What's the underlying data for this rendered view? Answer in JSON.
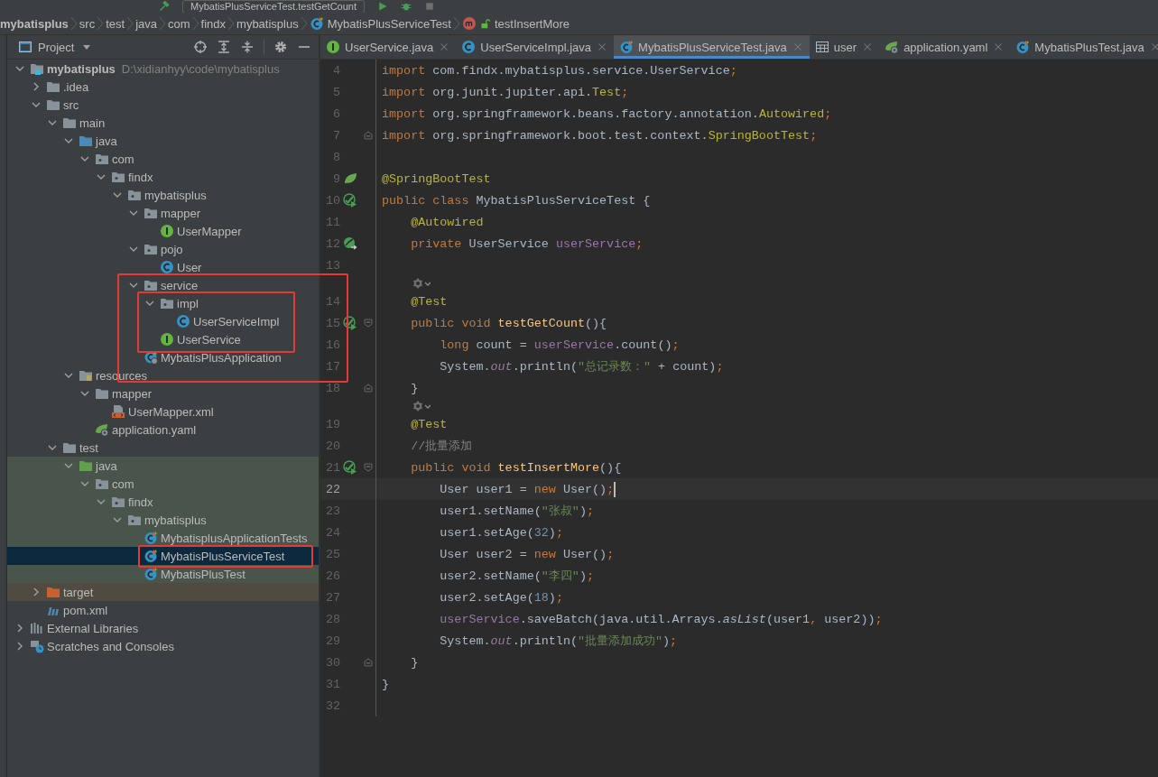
{
  "toolbar": {
    "run_configuration": "MybatisPlusServiceTest.testGetCount"
  },
  "breadcrumbs": [
    {
      "label": "mybatisplus",
      "kind": "module"
    },
    {
      "label": "src",
      "kind": "folder"
    },
    {
      "label": "test",
      "kind": "folder"
    },
    {
      "label": "java",
      "kind": "folder"
    },
    {
      "label": "com",
      "kind": "folder"
    },
    {
      "label": "findx",
      "kind": "folder"
    },
    {
      "label": "mybatisplus",
      "kind": "folder"
    },
    {
      "label": "MybatisPlusServiceTest",
      "kind": "test-class"
    },
    {
      "label": "testInsertMore",
      "kind": "method"
    }
  ],
  "project_panel": {
    "title": "Project",
    "tree": [
      {
        "label": "mybatisplus",
        "path": "D:\\xidianhyy\\code\\mybatisplus",
        "kind": "module",
        "expanded": true,
        "selected": false,
        "children": [
          {
            "label": ".idea",
            "kind": "folder",
            "expanded": false,
            "selected": false
          },
          {
            "label": "src",
            "kind": "folder",
            "expanded": true,
            "selected": false,
            "children": [
              {
                "label": "main",
                "kind": "folder",
                "expanded": true,
                "selected": false,
                "children": [
                  {
                    "label": "java",
                    "kind": "source",
                    "expanded": true,
                    "selected": false,
                    "children": [
                      {
                        "label": "com",
                        "kind": "package",
                        "expanded": true,
                        "selected": false,
                        "children": [
                          {
                            "label": "findx",
                            "kind": "package",
                            "expanded": true,
                            "selected": false,
                            "children": [
                              {
                                "label": "mybatisplus",
                                "kind": "package",
                                "expanded": true,
                                "selected": false,
                                "children": [
                                  {
                                    "label": "mapper",
                                    "kind": "package",
                                    "expanded": true,
                                    "selected": false,
                                    "children": [
                                      {
                                        "label": "UserMapper",
                                        "kind": "interface",
                                        "selected": false
                                      }
                                    ]
                                  },
                                  {
                                    "label": "pojo",
                                    "kind": "package",
                                    "expanded": true,
                                    "selected": false,
                                    "children": [
                                      {
                                        "label": "User",
                                        "kind": "class",
                                        "selected": false
                                      }
                                    ]
                                  },
                                  {
                                    "label": "service",
                                    "kind": "package",
                                    "expanded": true,
                                    "selected": false,
                                    "children": [
                                      {
                                        "label": "impl",
                                        "kind": "package",
                                        "expanded": true,
                                        "selected": false,
                                        "children": [
                                          {
                                            "label": "UserServiceImpl",
                                            "kind": "class",
                                            "selected": false
                                          }
                                        ]
                                      },
                                      {
                                        "label": "UserService",
                                        "kind": "interface",
                                        "selected": false
                                      }
                                    ]
                                  },
                                  {
                                    "label": "MybatisPlusApplication",
                                    "kind": "app-class",
                                    "selected": false
                                  }
                                ]
                              }
                            ]
                          }
                        ]
                      }
                    ]
                  },
                  {
                    "label": "resources",
                    "kind": "resources",
                    "expanded": true,
                    "selected": false,
                    "children": [
                      {
                        "label": "mapper",
                        "kind": "folder",
                        "expanded": true,
                        "selected": false,
                        "children": [
                          {
                            "label": "UserMapper.xml",
                            "kind": "xml",
                            "selected": false
                          }
                        ]
                      },
                      {
                        "label": "application.yaml",
                        "kind": "yaml",
                        "selected": false
                      }
                    ]
                  }
                ]
              },
              {
                "label": "test",
                "kind": "folder",
                "expanded": true,
                "selected": false,
                "children": [
                  {
                    "label": "java",
                    "kind": "test-folder",
                    "expanded": true,
                    "selected": false,
                    "children": [
                      {
                        "label": "com",
                        "kind": "package",
                        "expanded": true,
                        "selected": false,
                        "children": [
                          {
                            "label": "findx",
                            "kind": "package",
                            "expanded": true,
                            "selected": false,
                            "children": [
                              {
                                "label": "mybatisplus",
                                "kind": "package",
                                "expanded": true,
                                "selected": false,
                                "children": [
                                  {
                                    "label": "MybatisplusApplicationTests",
                                    "kind": "test-class",
                                    "selected": false
                                  },
                                  {
                                    "label": "MybatisPlusServiceTest",
                                    "kind": "test-class",
                                    "selected": true
                                  },
                                  {
                                    "label": "MybatisPlusTest",
                                    "kind": "test-class",
                                    "selected": false
                                  }
                                ]
                              }
                            ]
                          }
                        ]
                      }
                    ]
                  }
                ]
              }
            ]
          },
          {
            "label": "target",
            "kind": "excluded",
            "expanded": false,
            "selected": false
          },
          {
            "label": "pom.xml",
            "kind": "maven",
            "selected": false
          }
        ]
      },
      {
        "label": "External Libraries",
        "kind": "libraries",
        "expanded": false,
        "selected": false
      },
      {
        "label": "Scratches and Consoles",
        "kind": "scratches",
        "expanded": false,
        "selected": false
      }
    ]
  },
  "editor": {
    "tabs": [
      {
        "label": "UserService.java",
        "kind": "interface",
        "selected": false
      },
      {
        "label": "UserServiceImpl.java",
        "kind": "class",
        "selected": false
      },
      {
        "label": "MybatisPlusServiceTest.java",
        "kind": "test-class",
        "selected": true
      },
      {
        "label": "user",
        "kind": "table",
        "selected": false
      },
      {
        "label": "application.yaml",
        "kind": "yaml",
        "selected": false
      },
      {
        "label": "MybatisPlusTest.java",
        "kind": "test-class",
        "selected": false
      }
    ],
    "lines": [
      {
        "kind": "code",
        "number": "4",
        "current": false,
        "tokens": [
          {
            "kind": "keyword",
            "text": "import"
          },
          {
            "kind": "plain",
            "text": " com.findx.mybatisplus.service.UserService"
          },
          {
            "kind": "keyword",
            "text": ";"
          }
        ]
      },
      {
        "kind": "code",
        "number": "5",
        "current": false,
        "tokens": [
          {
            "kind": "keyword",
            "text": "import"
          },
          {
            "kind": "plain",
            "text": " org.junit.jupiter.api."
          },
          {
            "kind": "annotation",
            "text": "Test"
          },
          {
            "kind": "keyword",
            "text": ";"
          }
        ]
      },
      {
        "kind": "code",
        "number": "6",
        "current": false,
        "tokens": [
          {
            "kind": "keyword",
            "text": "import"
          },
          {
            "kind": "plain",
            "text": " org.springframework.beans.factory.annotation."
          },
          {
            "kind": "annotation",
            "text": "Autowired"
          },
          {
            "kind": "keyword",
            "text": ";"
          }
        ]
      },
      {
        "kind": "code",
        "number": "7",
        "current": false,
        "fold": {
          "kind": "end"
        },
        "tokens": [
          {
            "kind": "keyword",
            "text": "import"
          },
          {
            "kind": "plain",
            "text": " org.springframework.boot.test.context."
          },
          {
            "kind": "annotation",
            "text": "SpringBootTest"
          },
          {
            "kind": "keyword",
            "text": ";"
          }
        ]
      },
      {
        "kind": "code",
        "number": "8",
        "current": false
      },
      {
        "kind": "code",
        "number": "9",
        "current": false,
        "gutter": {
          "kind": "spring"
        },
        "tokens": [
          {
            "kind": "annotation",
            "text": "@SpringBootTest"
          }
        ]
      },
      {
        "kind": "code",
        "number": "10",
        "current": false,
        "gutter": {
          "kind": "run"
        },
        "tokens": [
          {
            "kind": "keyword",
            "text": "public class "
          },
          {
            "kind": "plain",
            "text": "MybatisPlusServiceTest {"
          }
        ]
      },
      {
        "kind": "code",
        "number": "11",
        "current": false,
        "tokens": [
          {
            "kind": "annotation",
            "text": "    @Autowired"
          }
        ]
      },
      {
        "kind": "code",
        "number": "12",
        "current": false,
        "gutter": {
          "kind": "bean"
        },
        "tokens": [
          {
            "kind": "keyword",
            "text": "    private "
          },
          {
            "kind": "plain",
            "text": "UserService "
          },
          {
            "kind": "field",
            "text": "userService"
          },
          {
            "kind": "keyword",
            "text": ";"
          }
        ]
      },
      {
        "kind": "code",
        "number": "13",
        "current": false
      },
      {
        "kind": "hint"
      },
      {
        "kind": "code",
        "number": "14",
        "current": false,
        "tokens": [
          {
            "kind": "annotation",
            "text": "    @Test"
          }
        ]
      },
      {
        "kind": "code",
        "number": "15",
        "current": false,
        "gutter": {
          "kind": "run"
        },
        "fold": {
          "kind": "start"
        },
        "tokens": [
          {
            "kind": "keyword",
            "text": "    public void "
          },
          {
            "kind": "method",
            "text": "testGetCount"
          },
          {
            "kind": "plain",
            "text": "(){"
          }
        ]
      },
      {
        "kind": "code",
        "number": "16",
        "current": false,
        "tokens": [
          {
            "kind": "keyword",
            "text": "        long "
          },
          {
            "kind": "plain",
            "text": "count = "
          },
          {
            "kind": "field",
            "text": "userService"
          },
          {
            "kind": "plain",
            "text": ".count()"
          },
          {
            "kind": "keyword",
            "text": ";"
          }
        ]
      },
      {
        "kind": "code",
        "number": "17",
        "current": false,
        "tokens": [
          {
            "kind": "plain",
            "text": "        System."
          },
          {
            "kind": "static",
            "text": "out"
          },
          {
            "kind": "plain",
            "text": ".println("
          },
          {
            "kind": "string",
            "text": "\"总记录数：\""
          },
          {
            "kind": "plain",
            "text": " + count)"
          },
          {
            "kind": "keyword",
            "text": ";"
          }
        ]
      },
      {
        "kind": "code",
        "number": "18",
        "current": false,
        "fold": {
          "kind": "end"
        },
        "tokens": [
          {
            "kind": "plain",
            "text": "    }"
          }
        ]
      },
      {
        "kind": "hint"
      },
      {
        "kind": "code",
        "number": "19",
        "current": false,
        "tokens": [
          {
            "kind": "annotation",
            "text": "    @Test"
          }
        ]
      },
      {
        "kind": "code",
        "number": "20",
        "current": false,
        "tokens": [
          {
            "kind": "comment",
            "text": "    //批量添加"
          }
        ]
      },
      {
        "kind": "code",
        "number": "21",
        "current": false,
        "gutter": {
          "kind": "run"
        },
        "fold": {
          "kind": "start"
        },
        "tokens": [
          {
            "kind": "keyword",
            "text": "    public void "
          },
          {
            "kind": "method",
            "text": "testInsertMore"
          },
          {
            "kind": "plain",
            "text": "(){"
          }
        ]
      },
      {
        "kind": "code",
        "number": "22",
        "current": true,
        "tokens": [
          {
            "kind": "plain",
            "text": "        User user1 = "
          },
          {
            "kind": "keyword",
            "text": "new "
          },
          {
            "kind": "plain",
            "text": "User()"
          },
          {
            "kind": "keyword",
            "text": ";"
          }
        ]
      },
      {
        "kind": "code",
        "number": "23",
        "current": false,
        "tokens": [
          {
            "kind": "plain",
            "text": "        user1.setName("
          },
          {
            "kind": "string",
            "text": "\"张叔\""
          },
          {
            "kind": "plain",
            "text": ")"
          },
          {
            "kind": "keyword",
            "text": ";"
          }
        ]
      },
      {
        "kind": "code",
        "number": "24",
        "current": false,
        "tokens": [
          {
            "kind": "plain",
            "text": "        user1.setAge("
          },
          {
            "kind": "number",
            "text": "32"
          },
          {
            "kind": "plain",
            "text": ")"
          },
          {
            "kind": "keyword",
            "text": ";"
          }
        ]
      },
      {
        "kind": "code",
        "number": "25",
        "current": false,
        "tokens": [
          {
            "kind": "plain",
            "text": "        User user2 = "
          },
          {
            "kind": "keyword",
            "text": "new "
          },
          {
            "kind": "plain",
            "text": "User()"
          },
          {
            "kind": "keyword",
            "text": ";"
          }
        ]
      },
      {
        "kind": "code",
        "number": "26",
        "current": false,
        "tokens": [
          {
            "kind": "plain",
            "text": "        user2.setName("
          },
          {
            "kind": "string",
            "text": "\"李四\""
          },
          {
            "kind": "plain",
            "text": ")"
          },
          {
            "kind": "keyword",
            "text": ";"
          }
        ]
      },
      {
        "kind": "code",
        "number": "27",
        "current": false,
        "tokens": [
          {
            "kind": "plain",
            "text": "        user2.setAge("
          },
          {
            "kind": "number",
            "text": "18"
          },
          {
            "kind": "plain",
            "text": ")"
          },
          {
            "kind": "keyword",
            "text": ";"
          }
        ]
      },
      {
        "kind": "code",
        "number": "28",
        "current": false,
        "tokens": [
          {
            "kind": "field",
            "text": "        userService"
          },
          {
            "kind": "plain",
            "text": ".saveBatch(java.util.Arrays."
          },
          {
            "kind": "italic",
            "text": "asList"
          },
          {
            "kind": "plain",
            "text": "(user1"
          },
          {
            "kind": "keyword",
            "text": ","
          },
          {
            "kind": "plain",
            "text": " user2))"
          },
          {
            "kind": "keyword",
            "text": ";"
          }
        ]
      },
      {
        "kind": "code",
        "number": "29",
        "current": false,
        "tokens": [
          {
            "kind": "plain",
            "text": "        System."
          },
          {
            "kind": "static",
            "text": "out"
          },
          {
            "kind": "plain",
            "text": ".println("
          },
          {
            "kind": "string",
            "text": "\"批量添加成功\""
          },
          {
            "kind": "plain",
            "text": ")"
          },
          {
            "kind": "keyword",
            "text": ";"
          }
        ]
      },
      {
        "kind": "code",
        "number": "30",
        "current": false,
        "fold": {
          "kind": "end"
        },
        "tokens": [
          {
            "kind": "plain",
            "text": "    }"
          }
        ]
      },
      {
        "kind": "code",
        "number": "31",
        "current": false,
        "tokens": [
          {
            "kind": "plain",
            "text": "}"
          }
        ]
      },
      {
        "kind": "code",
        "number": "32",
        "current": false
      }
    ]
  },
  "annotations": [
    {
      "kind": "frame"
    },
    {
      "kind": "frame"
    },
    {
      "kind": "frame"
    }
  ]
}
